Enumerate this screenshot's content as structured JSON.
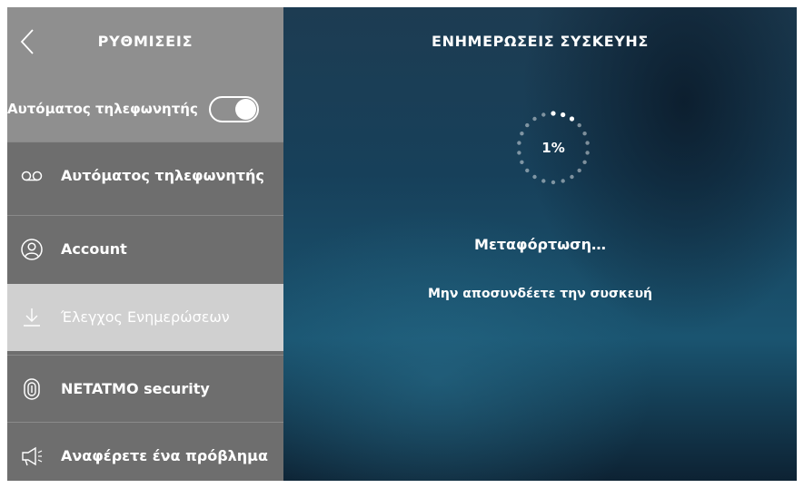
{
  "sidebar": {
    "title": "ΡΥΘΜΙΣΕΙΣ",
    "toggle": {
      "label": "Αυτόματος τηλεφωνητής",
      "on": true
    },
    "items": [
      {
        "label": "Αυτόματος τηλεφωνητής",
        "icon": "voicemail-icon"
      },
      {
        "label": "Account",
        "icon": "user-icon"
      },
      {
        "label": "Έλεγχος Ενημερώσεων",
        "icon": "download-icon",
        "selected": true
      },
      {
        "label": "NETATMO security",
        "icon": "fingerprint-icon"
      },
      {
        "label": "Αναφέρετε ένα πρόβλημα",
        "icon": "megaphone-icon"
      }
    ]
  },
  "main": {
    "title": "ΕΝΗΜΕΡΩΣΕΙΣ ΣΥΣΚΕΥΗΣ",
    "progress_label": "1%",
    "progress_value": 0.01,
    "status": "Μεταφόρτωση…",
    "subtext": "Μην αποσυνδέετε την συσκευή"
  },
  "colors": {
    "sidebar_bg": "#6e6e6e",
    "sidebar_header_bg": "#8f8f8f",
    "selected_bg": "#d0d0d0",
    "main_bg": "#17405a"
  }
}
